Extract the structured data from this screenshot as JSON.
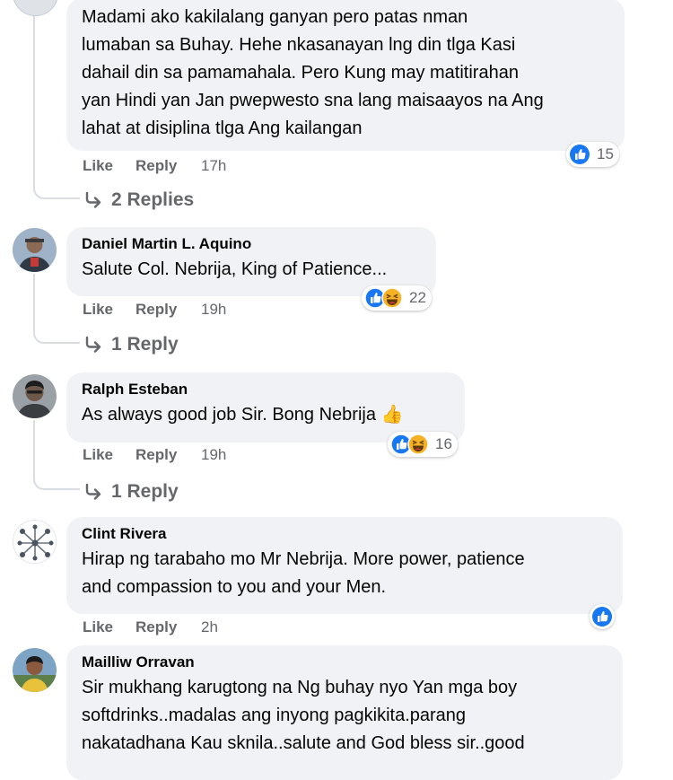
{
  "comments": [
    {
      "author": "",
      "text": "Madami ako kakilalang ganyan pero patas nman\nlumaban sa Buhay. Hehe nkasanayan lng din tlga Kasi\ndahail din sa pamamahala. Pero Kung may matitirahan\nyan Hindi yan Jan pwepwesto sna lang maisaayos na Ang\nlahat at disiplina tlga Ang kailangan",
      "like": "Like",
      "reply": "Reply",
      "time": "17h",
      "reaction_count": "15",
      "reactions": [
        "like-icon"
      ],
      "replies": "2 Replies"
    },
    {
      "author": "Daniel Martin L. Aquino",
      "text": "Salute Col. Nebrija, King of Patience...",
      "like": "Like",
      "reply": "Reply",
      "time": "19h",
      "reaction_count": "22",
      "reactions": [
        "like-icon",
        "haha-icon"
      ],
      "replies": "1 Reply"
    },
    {
      "author": "Ralph Esteban",
      "text": "As always good job Sir. Bong Nebrija 👍",
      "like": "Like",
      "reply": "Reply",
      "time": "19h",
      "reaction_count": "16",
      "reactions": [
        "like-icon",
        "haha-icon"
      ],
      "replies": "1 Reply"
    },
    {
      "author": "Clint Rivera",
      "text": "Hirap ng tarabaho mo Mr Nebrija. More power, patience\nand compassion to you and your Men.",
      "like": "Like",
      "reply": "Reply",
      "time": "2h",
      "reactions": [
        "like-icon"
      ]
    },
    {
      "author": "Mailliw Orravan",
      "text": "Sir mukhang karugtong na Ng buhay nyo Yan mga boy\nsoftdrinks..madalas ang inyong pagkikita.parang\nnakatadhana Kau sknila..salute and God bless sir..good"
    }
  ],
  "colors": {
    "bubble": "#f0f2f5",
    "meta_text": "#65676b",
    "like_blue": "#1877f2",
    "haha_yellow": "#f7b125"
  }
}
